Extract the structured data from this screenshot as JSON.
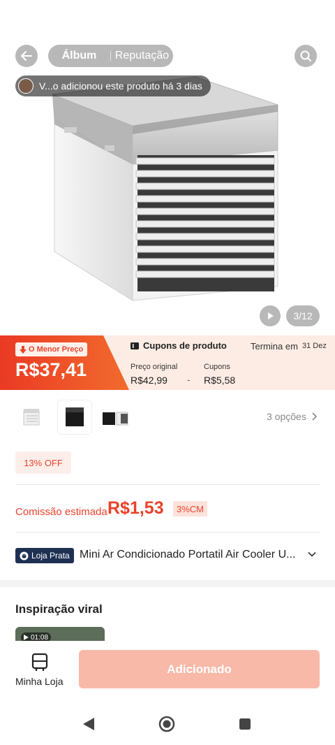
{
  "header": {
    "back_icon": "arrow-left-icon",
    "tabs": [
      "Álbum",
      "Reputação"
    ],
    "search_icon": "search-icon"
  },
  "notification": {
    "text": "V...o adicionou este produto há 3 dias"
  },
  "gallery": {
    "counter": "3/12",
    "play_icon": "play-icon"
  },
  "price_banner": {
    "lowest_badge": "O Menor Preço",
    "price": "R$37,41",
    "coupons_title": "Cupons de produto",
    "ends_label": "Termina em",
    "ends_date": "31 Dez",
    "original_label": "Preço original",
    "original_price": "R$42,99",
    "minus": "-",
    "coupon_label": "Cupons",
    "coupon_value": "R$5,58"
  },
  "variants": {
    "options_label": "3 opções"
  },
  "discount": {
    "label": "13% OFF"
  },
  "commission": {
    "label": "Comissão estimada",
    "value": "R$1,53",
    "badge": "3%CM"
  },
  "shop": {
    "badge": "Loja Prata",
    "product_title": "Mini Ar Condicionado Portatil Air Cooler U..."
  },
  "viral": {
    "title": "Inspiração viral",
    "video_duration": "01:08"
  },
  "bottom": {
    "my_store_label": "Minha Loja",
    "add_button": "Adicionado"
  },
  "colors": {
    "accent": "#e8432b",
    "banner_bg": "#fdece4",
    "add_button_bg": "#f9b9a8",
    "shop_badge_bg": "#1f3153"
  }
}
